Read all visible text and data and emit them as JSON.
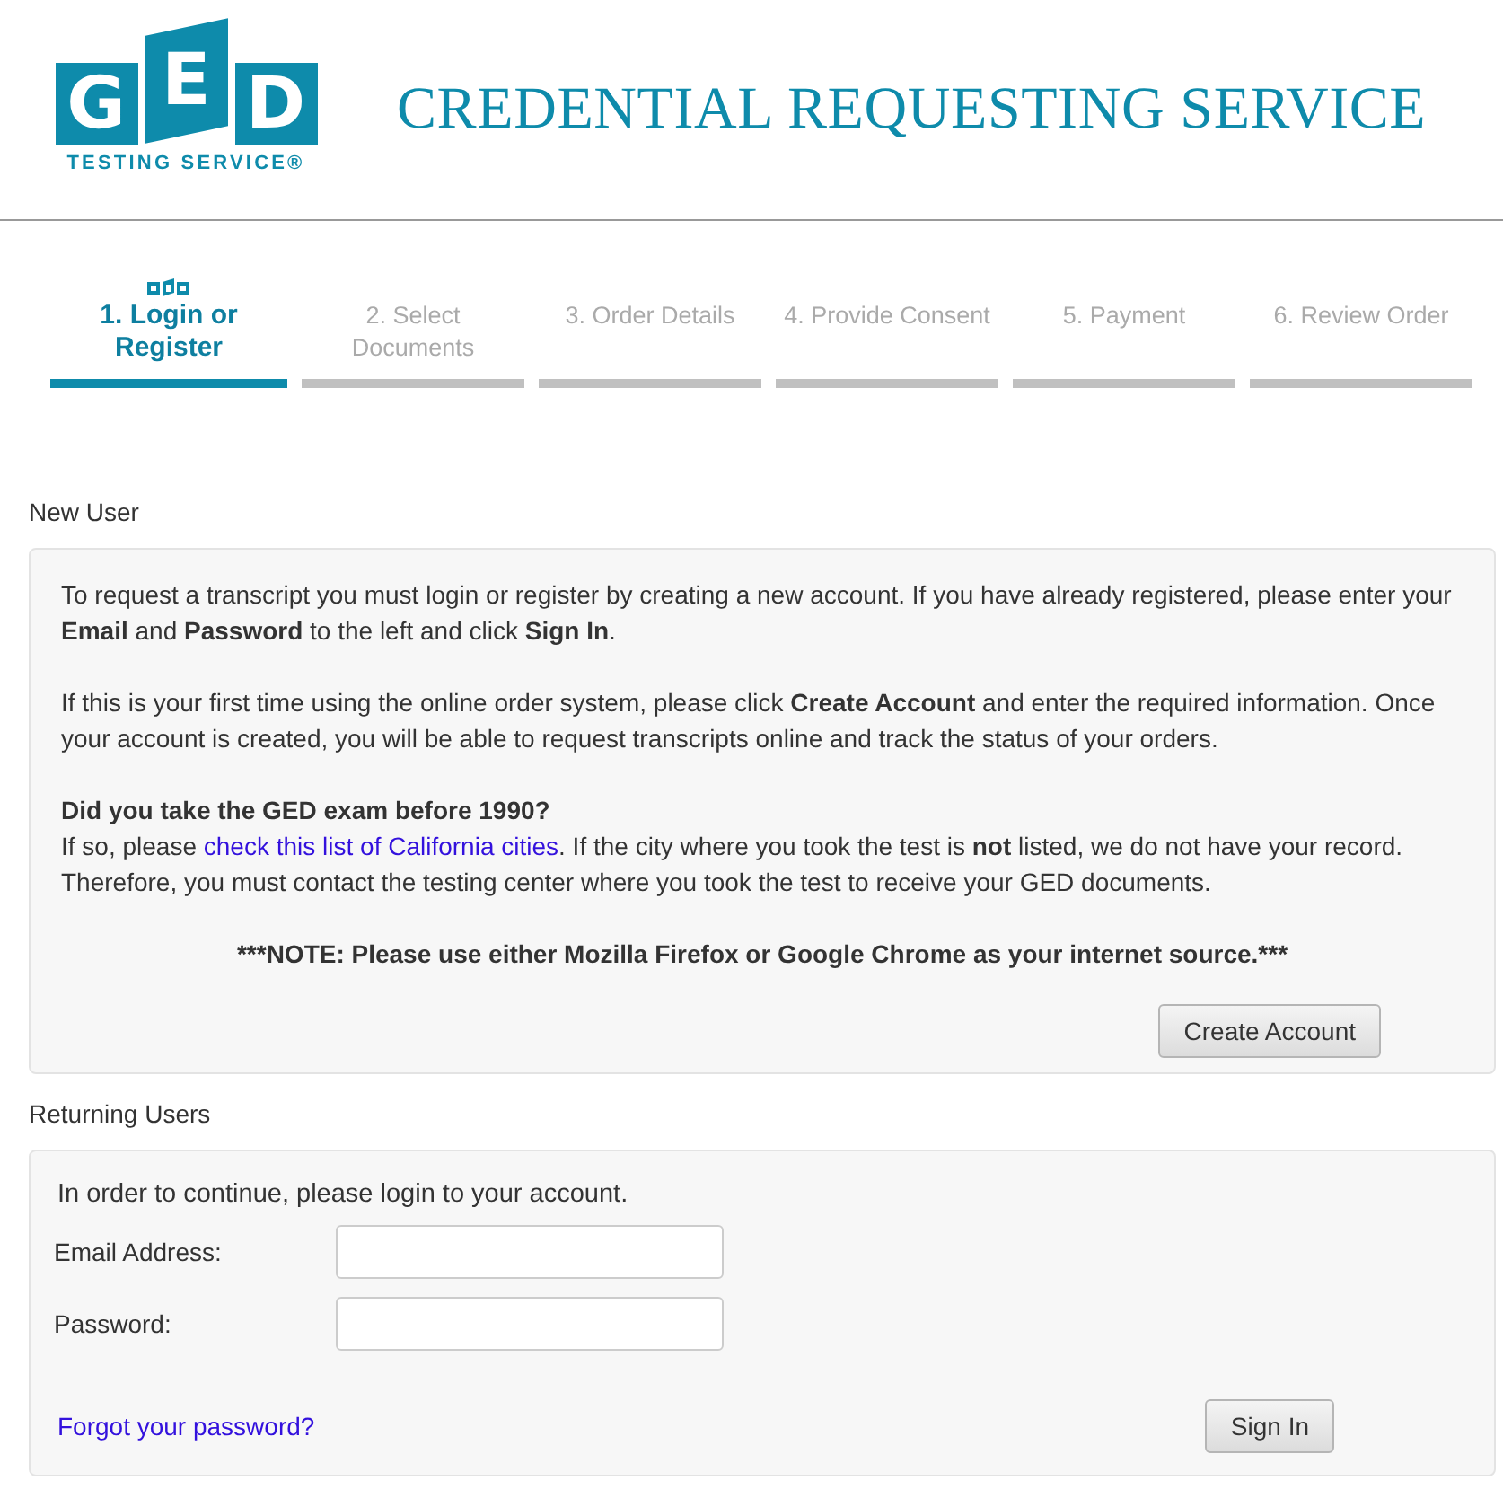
{
  "header": {
    "logo": {
      "letters": [
        "G",
        "E",
        "D"
      ],
      "tagline": "TESTING SERVICE®"
    },
    "title": "CREDENTIAL REQUESTING SERVICE"
  },
  "steps": [
    {
      "label": "1. Login or Register",
      "selected": true
    },
    {
      "label": "2. Select Documents",
      "selected": false
    },
    {
      "label": "3. Order Details",
      "selected": false
    },
    {
      "label": "4. Provide Consent",
      "selected": false
    },
    {
      "label": "5. Payment",
      "selected": false
    },
    {
      "label": "6. Review Order",
      "selected": false
    }
  ],
  "new_user": {
    "heading": "New User",
    "paragraphs": [
      "To request a transcript you must login or register by creating a new account. If you have already registered, please enter your **Email** and **Password** to the left and click **Sign In**.",
      "If this is your first time using the online order system, please click **Create Account** and enter the required information. Once your account is created, you will be able to request transcripts online and track the status of your orders."
    ],
    "question": "Did you take the GED exam before 1990?",
    "answer": {
      "before": "If so, please ",
      "link": "check this list of California cities",
      "after": ". If the city where you took the test is **not** listed, we do not have your record. Therefore, you must contact the testing center where you took the test to receive your GED documents."
    },
    "note": "***NOTE: Please use either Mozilla Firefox or Google Chrome as your internet source.***",
    "button": "Create Account"
  },
  "returning_users": {
    "heading": "Returning Users",
    "intro": "In order to continue, please login to your account.",
    "fields": [
      {
        "label": "Email Address:"
      },
      {
        "label": "Password:"
      }
    ],
    "forgot_link": "Forgot your password?",
    "button": "Sign In"
  }
}
